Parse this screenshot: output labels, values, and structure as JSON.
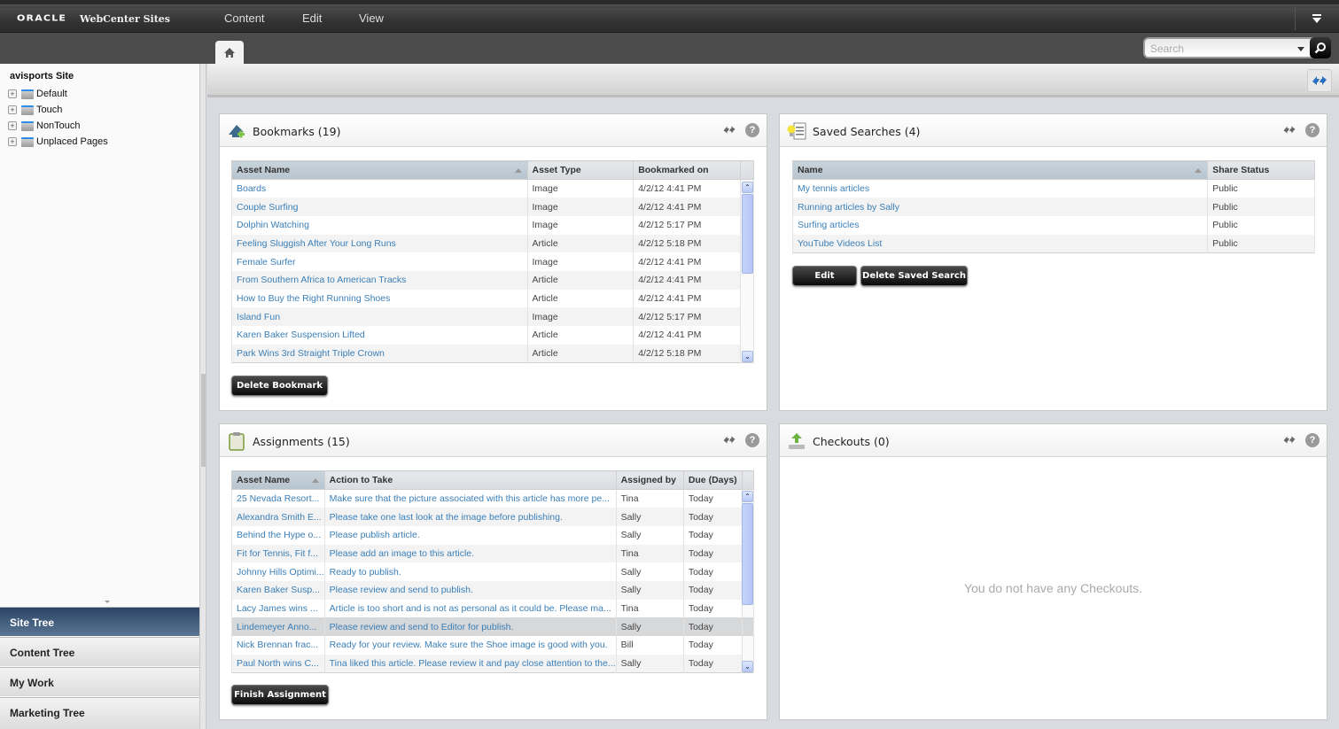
{
  "app": {
    "brand": "ORACLE",
    "product": "WebCenter Sites",
    "menus": [
      "Content",
      "Edit",
      "View"
    ]
  },
  "search": {
    "placeholder": "Search",
    "value": ""
  },
  "sidebar": {
    "site_title": "avisports Site",
    "tree": [
      {
        "label": "Default"
      },
      {
        "label": "Touch"
      },
      {
        "label": "NonTouch"
      },
      {
        "label": "Unplaced Pages"
      }
    ],
    "accordion": [
      {
        "label": "Site Tree",
        "active": true
      },
      {
        "label": "Content Tree",
        "active": false
      },
      {
        "label": "My Work",
        "active": false
      },
      {
        "label": "Marketing Tree",
        "active": false
      }
    ]
  },
  "bookmarks": {
    "title": "Bookmarks (19)",
    "columns": [
      "Asset Name",
      "Asset Type",
      "Bookmarked on"
    ],
    "rows": [
      [
        "Boards",
        "Image",
        "4/2/12 4:41 PM"
      ],
      [
        "Couple Surfing",
        "Image",
        "4/2/12 4:41 PM"
      ],
      [
        "Dolphin Watching",
        "Image",
        "4/2/12 5:17 PM"
      ],
      [
        "Feeling Sluggish After Your Long Runs",
        "Article",
        "4/2/12 5:18 PM"
      ],
      [
        "Female Surfer",
        "Image",
        "4/2/12 4:41 PM"
      ],
      [
        "From Southern Africa to American Tracks",
        "Article",
        "4/2/12 4:41 PM"
      ],
      [
        "How to Buy the Right Running Shoes",
        "Article",
        "4/2/12 4:41 PM"
      ],
      [
        "Island Fun",
        "Image",
        "4/2/12 5:17 PM"
      ],
      [
        "Karen Baker Suspension Lifted",
        "Article",
        "4/2/12 4:41 PM"
      ],
      [
        "Park Wins 3rd Straight Triple Crown",
        "Article",
        "4/2/12 5:18 PM"
      ]
    ],
    "delete_label": "Delete Bookmark"
  },
  "saved_searches": {
    "title": "Saved Searches (4)",
    "columns": [
      "Name",
      "Share Status"
    ],
    "rows": [
      [
        "My tennis articles",
        "Public"
      ],
      [
        "Running articles by Sally",
        "Public"
      ],
      [
        "Surfing articles",
        "Public"
      ],
      [
        "YouTube Videos List",
        "Public"
      ]
    ],
    "edit_label": "Edit",
    "delete_label": "Delete Saved Search"
  },
  "assignments": {
    "title": "Assignments (15)",
    "columns": [
      "Asset Name",
      "Action to Take",
      "Assigned by",
      "Due (Days)"
    ],
    "rows": [
      [
        "25 Nevada Resort...",
        "Make sure that the picture associated with this article has more pe...",
        "Tina",
        "Today"
      ],
      [
        "Alexandra Smith E...",
        "Please take one last look at the image before publishing.",
        "Sally",
        "Today"
      ],
      [
        "Behind the Hype o...",
        "Please publish article.",
        "Sally",
        "Today"
      ],
      [
        "Fit for Tennis, Fit f...",
        "Please add an image to this article.",
        "Tina",
        "Today"
      ],
      [
        "Johnny Hills Optimi...",
        "Ready to publish.",
        "Sally",
        "Today"
      ],
      [
        "Karen Baker Susp...",
        "Please review and send to publish.",
        "Sally",
        "Today"
      ],
      [
        "Lacy James wins ...",
        "Article is too short and is not as personal as it could be. Please ma...",
        "Tina",
        "Today"
      ],
      [
        "Lindemeyer Anno...",
        "Please review and send to Editor for publish.",
        "Sally",
        "Today"
      ],
      [
        "Nick Brennan frac...",
        "Ready for your review. Make sure the Shoe image is good with you.",
        "Bill",
        "Today"
      ],
      [
        "Paul North wins C...",
        "Tina liked this article. Please review it and pay close attention to the...",
        "Sally",
        "Today"
      ]
    ],
    "selected_row": 7,
    "finish_label": "Finish Assignment"
  },
  "checkouts": {
    "title": "Checkouts (0)",
    "empty_message": "You do not have any Checkouts."
  },
  "icons": {
    "home": "home-icon",
    "search": "magnifier-icon",
    "refresh": "refresh-arrows-icon",
    "help": "question-mark-icon",
    "bookmarks": "bookmark-add-icon",
    "saved_searches": "lightbulb-list-icon",
    "assignments": "clipboard-icon",
    "checkouts": "upload-tray-icon"
  }
}
